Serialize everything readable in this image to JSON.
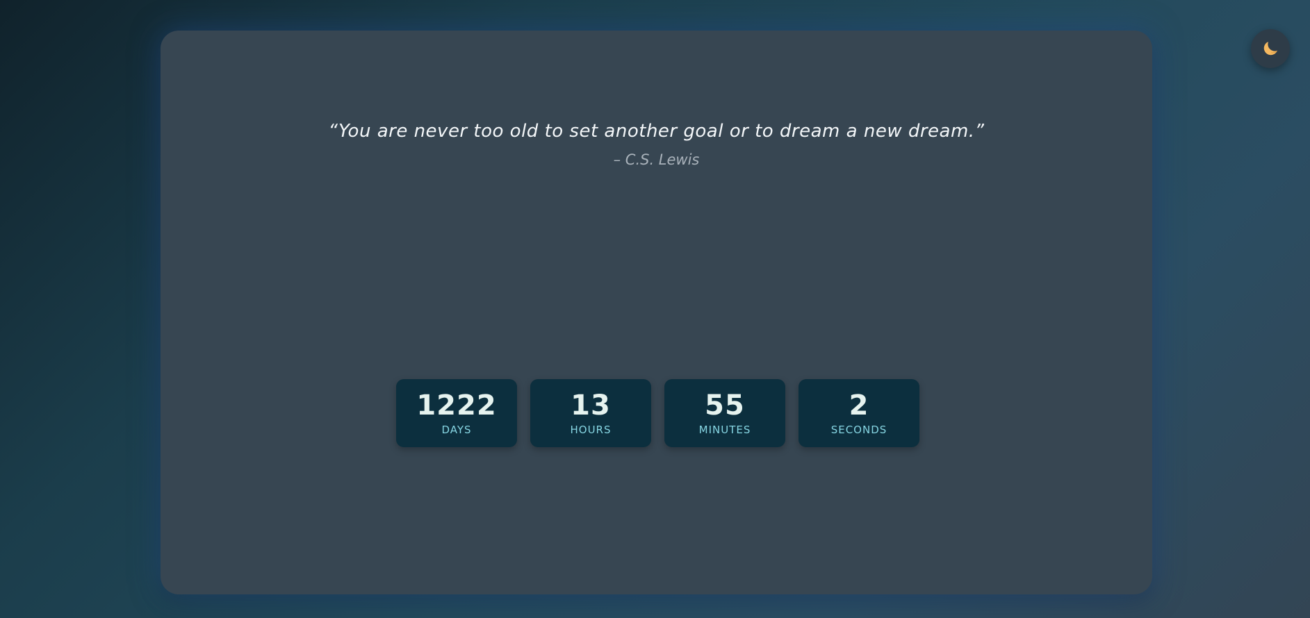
{
  "quote": {
    "text": "“You are never too old to set another goal or to dream a new dream.”",
    "author": "– C.S. Lewis"
  },
  "countdown": [
    {
      "value": "1222",
      "label": "DAYS"
    },
    {
      "value": "13",
      "label": "HOURS"
    },
    {
      "value": "55",
      "label": "MINUTES"
    },
    {
      "value": "2",
      "label": "SECONDS"
    }
  ],
  "theme_toggle": {
    "icon": "moon-icon",
    "icon_color": "#f4b860"
  },
  "colors": {
    "card": "#374652",
    "counter_box": "#0c2f3e",
    "counter_value": "#e6f3ef",
    "counter_label": "#87d6e3"
  }
}
